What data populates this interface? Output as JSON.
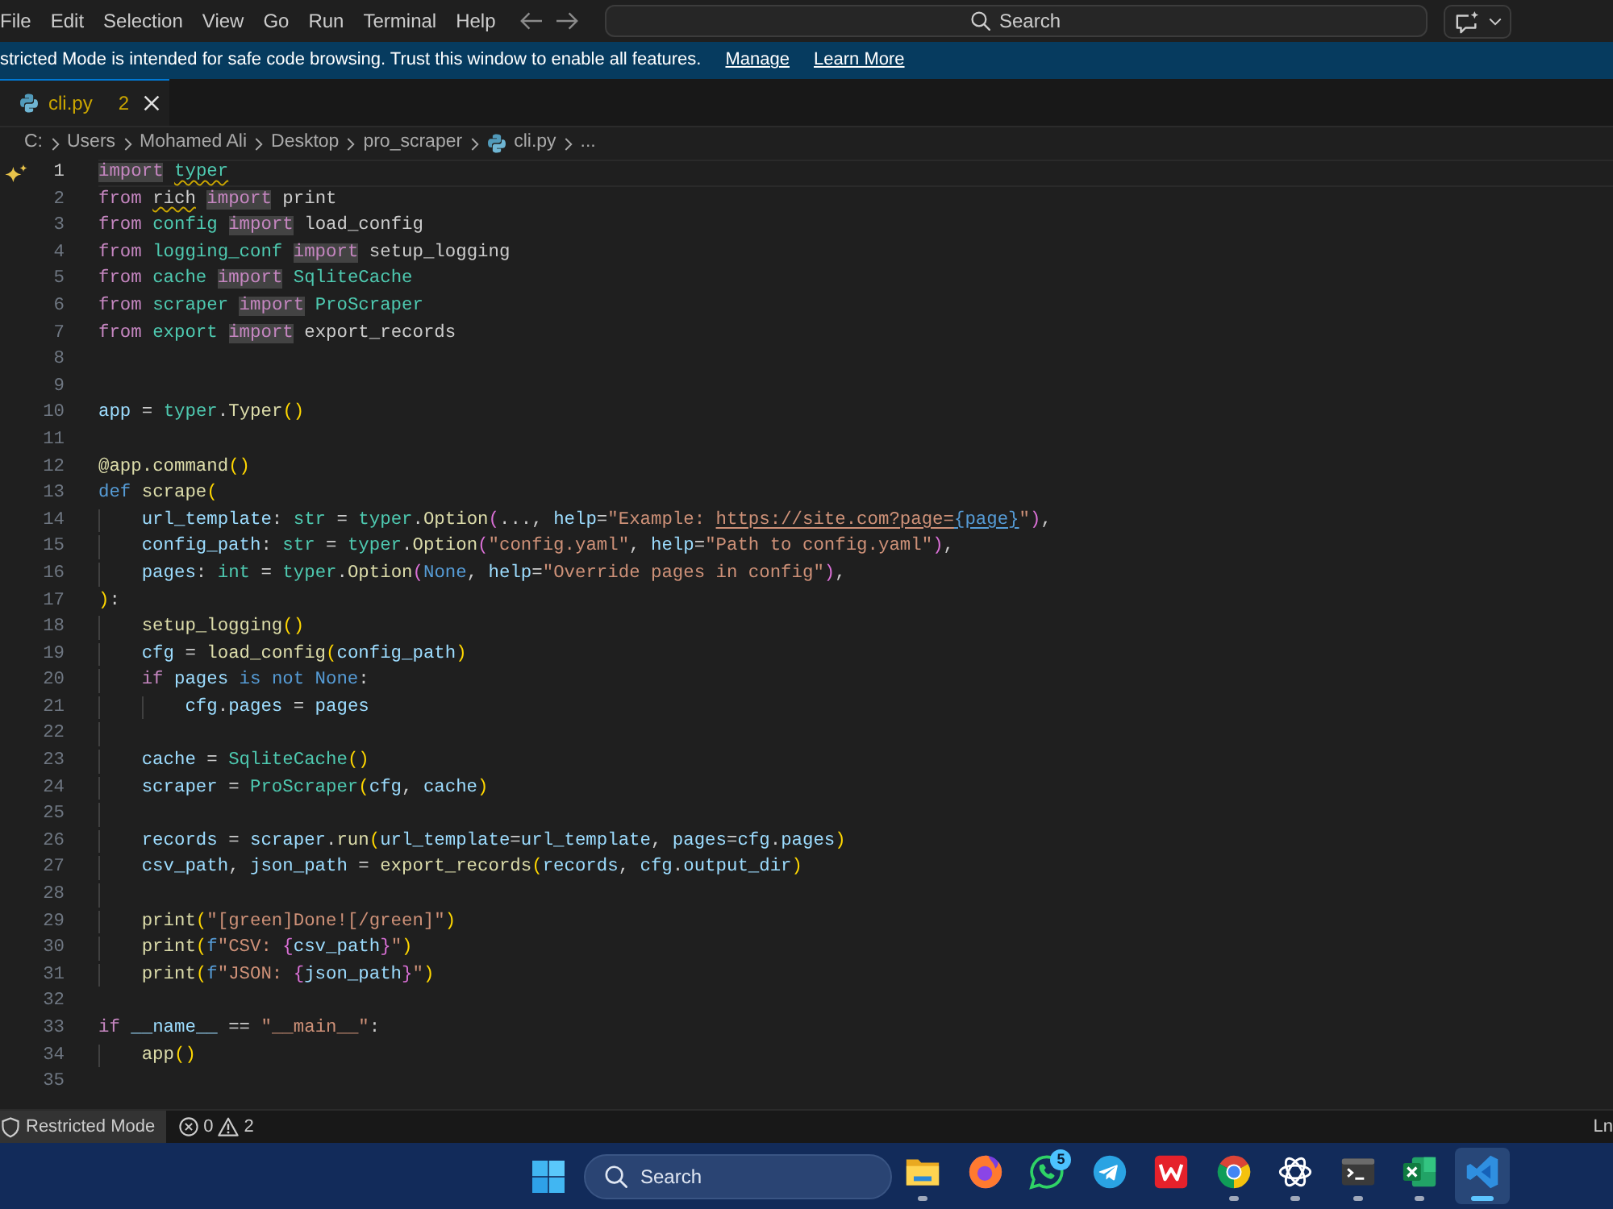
{
  "menu": [
    "File",
    "Edit",
    "Selection",
    "View",
    "Go",
    "Run",
    "Terminal",
    "Help"
  ],
  "command_center": {
    "label": "Search"
  },
  "banner": {
    "message": "stricted Mode is intended for safe code browsing. Trust this window to enable all features.",
    "links": [
      "Manage",
      "Learn More"
    ]
  },
  "tabs": [
    {
      "label": "cli.py",
      "problems": "2",
      "selected": true
    }
  ],
  "breadcrumb": [
    {
      "kind": "folder",
      "label": "C:"
    },
    {
      "kind": "folder",
      "label": "Users"
    },
    {
      "kind": "folder",
      "label": "Mohamed Ali"
    },
    {
      "kind": "folder",
      "label": "Desktop"
    },
    {
      "kind": "folder",
      "label": "pro_scraper"
    },
    {
      "kind": "file",
      "label": "cli.py"
    },
    {
      "kind": "symbols",
      "label": "..."
    }
  ],
  "editor": {
    "lines": [
      {
        "number": "1",
        "active": true,
        "tokens": [
          {
            "kind": "keyword-match",
            "text": "import"
          },
          {
            "kind": "module-warning",
            "text": " typer"
          }
        ]
      },
      {
        "number": "2",
        "active": false,
        "tokens": [
          {
            "kind": "keyword",
            "text": "from "
          },
          {
            "kind": "plain-warning",
            "text": "rich"
          },
          {
            "kind": "keyword-match",
            "text": " import"
          },
          {
            "kind": "plain",
            "text": " print"
          }
        ]
      },
      {
        "number": "3",
        "active": false,
        "tokens": [
          {
            "kind": "keyword",
            "text": "from "
          },
          {
            "kind": "module",
            "text": "config"
          },
          {
            "kind": "keyword-match",
            "text": " import"
          },
          {
            "kind": "plain",
            "text": " load_config"
          }
        ]
      },
      {
        "number": "4",
        "active": false,
        "tokens": [
          {
            "kind": "keyword",
            "text": "from "
          },
          {
            "kind": "module",
            "text": "logging_conf"
          },
          {
            "kind": "keyword-match",
            "text": " import"
          },
          {
            "kind": "plain",
            "text": " setup_logging"
          }
        ]
      },
      {
        "number": "5",
        "active": false,
        "tokens": [
          {
            "kind": "keyword",
            "text": "from "
          },
          {
            "kind": "module",
            "text": "cache"
          },
          {
            "kind": "keyword-match",
            "text": " import"
          },
          {
            "kind": "module",
            "text": " SqliteCache"
          }
        ]
      },
      {
        "number": "6",
        "active": false,
        "tokens": [
          {
            "kind": "keyword",
            "text": "from "
          },
          {
            "kind": "module",
            "text": "scraper"
          },
          {
            "kind": "keyword-match",
            "text": " import"
          },
          {
            "kind": "module",
            "text": " ProScraper"
          }
        ]
      },
      {
        "number": "7",
        "active": false,
        "tokens": [
          {
            "kind": "keyword",
            "text": "from "
          },
          {
            "kind": "module",
            "text": "export"
          },
          {
            "kind": "keyword-match",
            "text": " import"
          },
          {
            "kind": "plain",
            "text": " export_records"
          }
        ]
      },
      {
        "number": "8",
        "active": false
      },
      {
        "number": "9",
        "active": false
      },
      {
        "number": "10",
        "active": false,
        "tokens": [
          {
            "kind": "variable",
            "text": "app"
          },
          {
            "kind": "plain",
            "text": " = "
          },
          {
            "kind": "module",
            "text": "typer"
          },
          {
            "kind": "plain",
            "text": "."
          },
          {
            "kind": "function",
            "text": "Typer"
          },
          {
            "kind": "bracket-1",
            "text": "()"
          }
        ]
      },
      {
        "number": "11",
        "active": false
      },
      {
        "number": "12",
        "active": false,
        "tokens": [
          {
            "kind": "function",
            "text": "@app.command"
          },
          {
            "kind": "bracket-1",
            "text": "()"
          }
        ]
      },
      {
        "number": "13",
        "active": false,
        "tokens": [
          {
            "kind": "storage",
            "text": "def "
          },
          {
            "kind": "function",
            "text": "scrape"
          },
          {
            "kind": "bracket-1",
            "text": "("
          }
        ]
      },
      {
        "number": "14",
        "active": false,
        "tokens": [
          {
            "kind": "variable",
            "text": "    url_template"
          },
          {
            "kind": "plain",
            "text": ": "
          },
          {
            "kind": "module",
            "text": "str"
          },
          {
            "kind": "plain",
            "text": " = "
          },
          {
            "kind": "module",
            "text": "typer"
          },
          {
            "kind": "plain",
            "text": "."
          },
          {
            "kind": "function",
            "text": "Option"
          },
          {
            "kind": "bracket-2",
            "text": "("
          },
          {
            "kind": "plain",
            "text": "..., "
          },
          {
            "kind": "variable",
            "text": "help"
          },
          {
            "kind": "plain",
            "text": "="
          },
          {
            "kind": "string",
            "text": "\"Example: "
          },
          {
            "kind": "link",
            "text": "https://site.com?page="
          },
          {
            "kind": "link-placeholder",
            "text": "{page}"
          },
          {
            "kind": "string",
            "text": "\""
          },
          {
            "kind": "bracket-2",
            "text": ")"
          },
          {
            "kind": "plain",
            "text": ","
          }
        ]
      },
      {
        "number": "15",
        "active": false,
        "tokens": [
          {
            "kind": "variable",
            "text": "    config_path"
          },
          {
            "kind": "plain",
            "text": ": "
          },
          {
            "kind": "module",
            "text": "str"
          },
          {
            "kind": "plain",
            "text": " = "
          },
          {
            "kind": "module",
            "text": "typer"
          },
          {
            "kind": "plain",
            "text": "."
          },
          {
            "kind": "function",
            "text": "Option"
          },
          {
            "kind": "bracket-2",
            "text": "("
          },
          {
            "kind": "string",
            "text": "\"config.yaml\""
          },
          {
            "kind": "plain",
            "text": ", "
          },
          {
            "kind": "variable",
            "text": "help"
          },
          {
            "kind": "plain",
            "text": "="
          },
          {
            "kind": "string",
            "text": "\"Path to config.yaml\""
          },
          {
            "kind": "bracket-2",
            "text": ")"
          },
          {
            "kind": "plain",
            "text": ","
          }
        ]
      },
      {
        "number": "16",
        "active": false,
        "tokens": [
          {
            "kind": "variable",
            "text": "    pages"
          },
          {
            "kind": "plain",
            "text": ": "
          },
          {
            "kind": "module",
            "text": "int"
          },
          {
            "kind": "plain",
            "text": " = "
          },
          {
            "kind": "module",
            "text": "typer"
          },
          {
            "kind": "plain",
            "text": "."
          },
          {
            "kind": "function",
            "text": "Option"
          },
          {
            "kind": "bracket-2",
            "text": "("
          },
          {
            "kind": "storage",
            "text": "None"
          },
          {
            "kind": "plain",
            "text": ", "
          },
          {
            "kind": "variable",
            "text": "help"
          },
          {
            "kind": "plain",
            "text": "="
          },
          {
            "kind": "string",
            "text": "\"Override pages in config\""
          },
          {
            "kind": "bracket-2",
            "text": ")"
          },
          {
            "kind": "plain",
            "text": ","
          }
        ]
      },
      {
        "number": "17",
        "active": false,
        "tokens": [
          {
            "kind": "bracket-1",
            "text": ")"
          },
          {
            "kind": "plain",
            "text": ":"
          }
        ]
      },
      {
        "number": "18",
        "active": false,
        "tokens": [
          {
            "kind": "function",
            "text": "    setup_logging"
          },
          {
            "kind": "bracket-1",
            "text": "()"
          }
        ]
      },
      {
        "number": "19",
        "active": false,
        "tokens": [
          {
            "kind": "variable",
            "text": "    cfg"
          },
          {
            "kind": "plain",
            "text": " = "
          },
          {
            "kind": "function",
            "text": "load_config"
          },
          {
            "kind": "bracket-1",
            "text": "("
          },
          {
            "kind": "variable",
            "text": "config_path"
          },
          {
            "kind": "bracket-1",
            "text": ")"
          }
        ]
      },
      {
        "number": "20",
        "active": false,
        "tokens": [
          {
            "kind": "keyword",
            "text": "    if "
          },
          {
            "kind": "variable",
            "text": "pages "
          },
          {
            "kind": "storage",
            "text": "is not None"
          },
          {
            "kind": "plain",
            "text": ":"
          }
        ]
      },
      {
        "number": "21",
        "active": false,
        "tokens": [
          {
            "kind": "variable",
            "text": "        cfg"
          },
          {
            "kind": "plain",
            "text": "."
          },
          {
            "kind": "variable",
            "text": "pages"
          },
          {
            "kind": "plain",
            "text": " = "
          },
          {
            "kind": "variable",
            "text": "pages"
          }
        ]
      },
      {
        "number": "22",
        "active": false
      },
      {
        "number": "23",
        "active": false,
        "tokens": [
          {
            "kind": "variable",
            "text": "    cache"
          },
          {
            "kind": "plain",
            "text": " = "
          },
          {
            "kind": "module",
            "text": "SqliteCache"
          },
          {
            "kind": "bracket-1",
            "text": "()"
          }
        ]
      },
      {
        "number": "24",
        "active": false,
        "tokens": [
          {
            "kind": "variable",
            "text": "    scraper"
          },
          {
            "kind": "plain",
            "text": " = "
          },
          {
            "kind": "module",
            "text": "ProScraper"
          },
          {
            "kind": "bracket-1",
            "text": "("
          },
          {
            "kind": "variable",
            "text": "cfg"
          },
          {
            "kind": "plain",
            "text": ", "
          },
          {
            "kind": "variable",
            "text": "cache"
          },
          {
            "kind": "bracket-1",
            "text": ")"
          }
        ]
      },
      {
        "number": "25",
        "active": false
      },
      {
        "number": "26",
        "active": false,
        "tokens": [
          {
            "kind": "variable",
            "text": "    records"
          },
          {
            "kind": "plain",
            "text": " = "
          },
          {
            "kind": "variable",
            "text": "scraper"
          },
          {
            "kind": "plain",
            "text": "."
          },
          {
            "kind": "function",
            "text": "run"
          },
          {
            "kind": "bracket-1",
            "text": "("
          },
          {
            "kind": "variable",
            "text": "url_template"
          },
          {
            "kind": "plain",
            "text": "="
          },
          {
            "kind": "variable",
            "text": "url_template"
          },
          {
            "kind": "plain",
            "text": ", "
          },
          {
            "kind": "variable",
            "text": "pages"
          },
          {
            "kind": "plain",
            "text": "="
          },
          {
            "kind": "variable",
            "text": "cfg"
          },
          {
            "kind": "plain",
            "text": "."
          },
          {
            "kind": "variable",
            "text": "pages"
          },
          {
            "kind": "bracket-1",
            "text": ")"
          }
        ]
      },
      {
        "number": "27",
        "active": false,
        "tokens": [
          {
            "kind": "variable",
            "text": "    csv_path"
          },
          {
            "kind": "plain",
            "text": ", "
          },
          {
            "kind": "variable",
            "text": "json_path"
          },
          {
            "kind": "plain",
            "text": " = "
          },
          {
            "kind": "function",
            "text": "export_records"
          },
          {
            "kind": "bracket-1",
            "text": "("
          },
          {
            "kind": "variable",
            "text": "records"
          },
          {
            "kind": "plain",
            "text": ", "
          },
          {
            "kind": "variable",
            "text": "cfg"
          },
          {
            "kind": "plain",
            "text": "."
          },
          {
            "kind": "variable",
            "text": "output_dir"
          },
          {
            "kind": "bracket-1",
            "text": ")"
          }
        ]
      },
      {
        "number": "28",
        "active": false
      },
      {
        "number": "29",
        "active": false,
        "tokens": [
          {
            "kind": "function",
            "text": "    print"
          },
          {
            "kind": "bracket-1",
            "text": "("
          },
          {
            "kind": "string",
            "text": "\"[green]Done![/green]\""
          },
          {
            "kind": "bracket-1",
            "text": ")"
          }
        ]
      },
      {
        "number": "30",
        "active": false,
        "tokens": [
          {
            "kind": "function",
            "text": "    print"
          },
          {
            "kind": "bracket-1",
            "text": "("
          },
          {
            "kind": "storage",
            "text": "f"
          },
          {
            "kind": "string",
            "text": "\"CSV: "
          },
          {
            "kind": "bracket-2",
            "text": "{"
          },
          {
            "kind": "variable",
            "text": "csv_path"
          },
          {
            "kind": "bracket-2",
            "text": "}"
          },
          {
            "kind": "string",
            "text": "\""
          },
          {
            "kind": "bracket-1",
            "text": ")"
          }
        ]
      },
      {
        "number": "31",
        "active": false,
        "tokens": [
          {
            "kind": "function",
            "text": "    print"
          },
          {
            "kind": "bracket-1",
            "text": "("
          },
          {
            "kind": "storage",
            "text": "f"
          },
          {
            "kind": "string",
            "text": "\"JSON: "
          },
          {
            "kind": "bracket-2",
            "text": "{"
          },
          {
            "kind": "variable",
            "text": "json_path"
          },
          {
            "kind": "bracket-2",
            "text": "}"
          },
          {
            "kind": "string",
            "text": "\""
          },
          {
            "kind": "bracket-1",
            "text": ")"
          }
        ]
      },
      {
        "number": "32",
        "active": false
      },
      {
        "number": "33",
        "active": false,
        "tokens": [
          {
            "kind": "keyword",
            "text": "if "
          },
          {
            "kind": "variable",
            "text": "__name__"
          },
          {
            "kind": "plain",
            "text": " == "
          },
          {
            "kind": "string",
            "text": "\"__main__\""
          },
          {
            "kind": "plain",
            "text": ":"
          }
        ]
      },
      {
        "number": "34",
        "active": false,
        "tokens": [
          {
            "kind": "function",
            "text": "    app"
          },
          {
            "kind": "bracket-1",
            "text": "()"
          }
        ]
      },
      {
        "number": "35",
        "active": false
      }
    ]
  },
  "status_bar": {
    "mode": "Restricted Mode",
    "errors": "0",
    "warnings": "2",
    "position": "Ln"
  },
  "taskbar": {
    "search": {
      "label": "Search"
    },
    "apps": [
      {
        "kind": "explorer",
        "running": true,
        "selected": false
      },
      {
        "kind": "firefox",
        "running": false,
        "selected": false
      },
      {
        "kind": "whatsapp",
        "running": false,
        "selected": false,
        "badge": "5"
      },
      {
        "kind": "telegram",
        "running": false,
        "selected": false
      },
      {
        "kind": "wps",
        "running": false,
        "selected": false
      },
      {
        "kind": "chrome",
        "running": true,
        "selected": false
      },
      {
        "kind": "chatgpt",
        "running": true,
        "selected": false
      },
      {
        "kind": "terminal",
        "running": true,
        "selected": false
      },
      {
        "kind": "excel",
        "running": true,
        "selected": false
      },
      {
        "kind": "vscode",
        "running": true,
        "selected": true
      }
    ]
  }
}
